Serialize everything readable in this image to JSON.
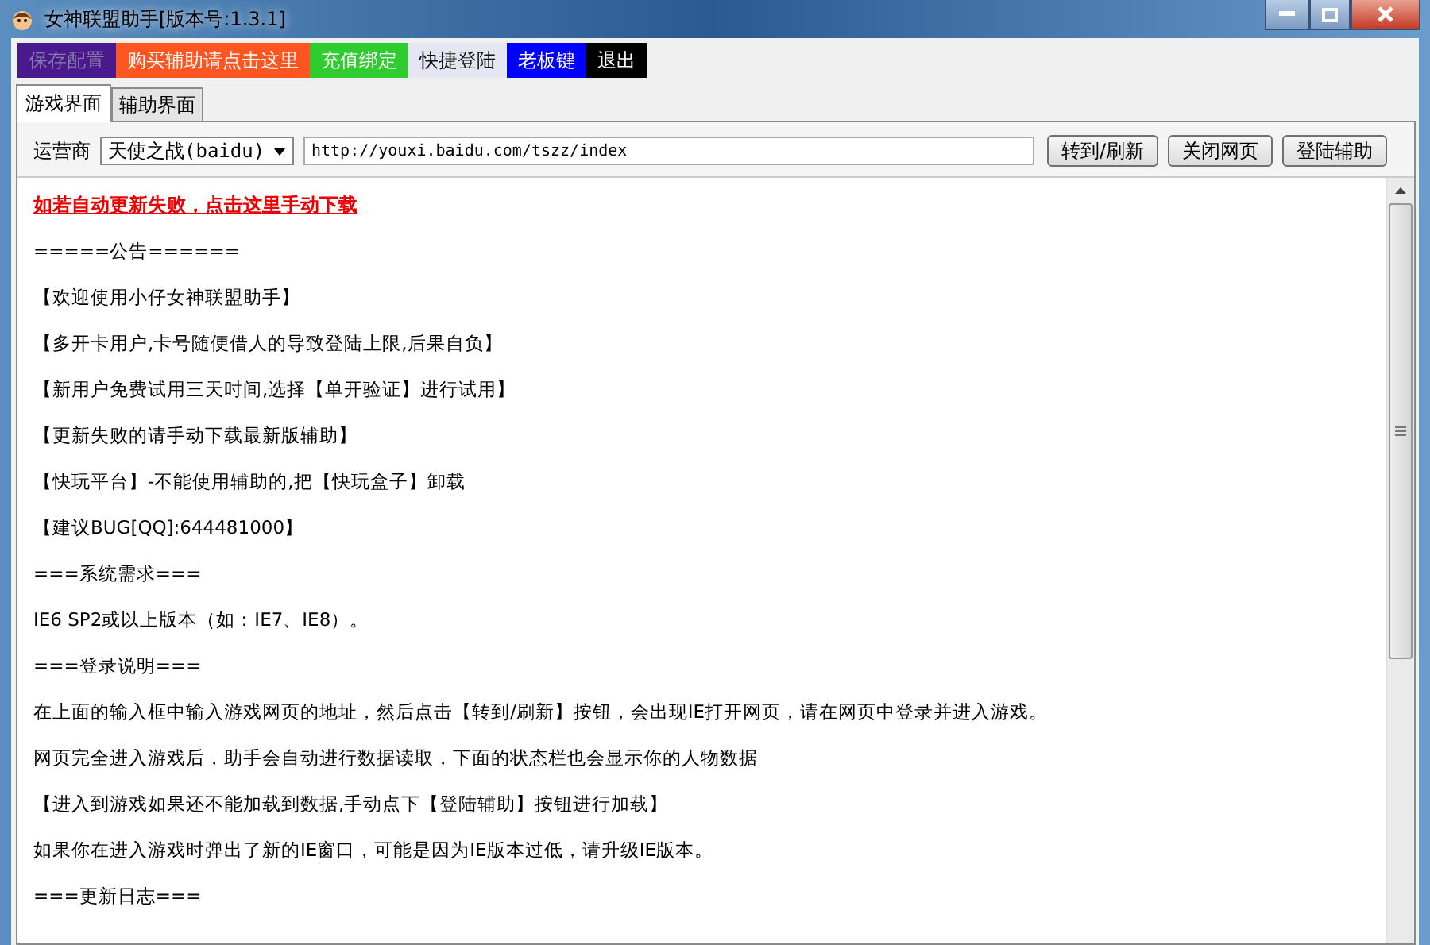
{
  "window": {
    "title": "女神联盟助手[版本号:1.3.1]"
  },
  "menu": [
    {
      "label": "保存配置",
      "color": "#4a1a8c",
      "disabled": true
    },
    {
      "label": "购买辅助请点击这里",
      "color": "#ff5520",
      "disabled": false
    },
    {
      "label": "充值绑定",
      "color": "#2ecc2e",
      "disabled": false
    },
    {
      "label": "快捷登陆",
      "color": "#e6e6f2",
      "disabled": false
    },
    {
      "label": "老板键",
      "color": "#0000ff",
      "disabled": false
    },
    {
      "label": "退出",
      "color": "#000000",
      "disabled": false
    }
  ],
  "tabs": [
    {
      "label": "游戏界面",
      "selected": true
    },
    {
      "label": "辅助界面",
      "selected": false
    }
  ],
  "toolbar": {
    "operator_label": "运营商",
    "operator": "天使之战(baidu)",
    "url": "http://youxi.baidu.com/tszz/index",
    "buttons": [
      "转到/刷新",
      "关闭网页",
      "登陆辅助"
    ]
  },
  "content": [
    {
      "kind": "link",
      "text": "如若自动更新失败，点击这里手动下载"
    },
    {
      "kind": "text",
      "text": "=====公告======"
    },
    {
      "kind": "text",
      "text": "【欢迎使用小仔女神联盟助手】"
    },
    {
      "kind": "text",
      "text": "【多开卡用户,卡号随便借人的导致登陆上限,后果自负】"
    },
    {
      "kind": "text",
      "text": "【新用户免费试用三天时间,选择【单开验证】进行试用】"
    },
    {
      "kind": "text",
      "text": "【更新失败的请手动下载最新版辅助】"
    },
    {
      "kind": "text",
      "text": "【快玩平台】-不能使用辅助的,把【快玩盒子】卸载"
    },
    {
      "kind": "text",
      "text": "【建议BUG[QQ]:644481000】"
    },
    {
      "kind": "text",
      "text": "===系统需求==="
    },
    {
      "kind": "text",
      "text": "IE6 SP2或以上版本（如：IE7、IE8）。"
    },
    {
      "kind": "text",
      "text": "===登录说明==="
    },
    {
      "kind": "text",
      "text": "在上面的输入框中输入游戏网页的地址，然后点击【转到/刷新】按钮，会出现IE打开网页，请在网页中登录并进入游戏。"
    },
    {
      "kind": "text",
      "text": "网页完全进入游戏后，助手会自动进行数据读取，下面的状态栏也会显示你的人物数据"
    },
    {
      "kind": "text",
      "text": "【进入到游戏如果还不能加载到数据,手动点下【登陆辅助】按钮进行加载】"
    },
    {
      "kind": "text",
      "text": "如果你在进入游戏时弹出了新的IE窗口，可能是因为IE版本过低，请升级IE版本。"
    },
    {
      "kind": "text",
      "text": "===更新日志==="
    }
  ]
}
